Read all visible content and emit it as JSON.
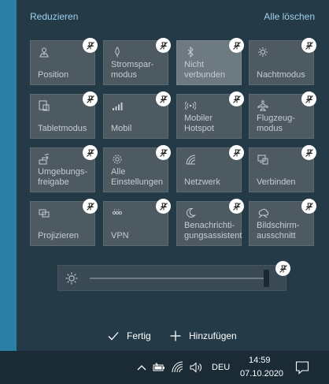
{
  "header": {
    "collapse_label": "Reduzieren",
    "clear_all_label": "Alle löschen"
  },
  "tiles": [
    {
      "label": "Position",
      "icon": "location-icon",
      "active": false
    },
    {
      "label": "Stromspar-\nmodus",
      "icon": "battery-saver-icon",
      "active": false
    },
    {
      "label": "Nicht\nverbunden",
      "icon": "bluetooth-icon",
      "active": true
    },
    {
      "label": "Nachtmodus",
      "icon": "night-light-icon",
      "active": false
    },
    {
      "label": "Tabletmodus",
      "icon": "tablet-mode-icon",
      "active": false
    },
    {
      "label": "Mobil",
      "icon": "cellular-icon",
      "active": false
    },
    {
      "label": "Mobiler\nHotspot",
      "icon": "hotspot-icon",
      "active": false
    },
    {
      "label": "Flugzeug-\nmodus",
      "icon": "airplane-icon",
      "active": false
    },
    {
      "label": "Umgebungs-\nfreigabe",
      "icon": "nearby-share-icon",
      "active": false
    },
    {
      "label": "Alle\nEinstellungen",
      "icon": "gear-icon",
      "active": false
    },
    {
      "label": "Netzwerk",
      "icon": "network-icon",
      "active": false
    },
    {
      "label": "Verbinden",
      "icon": "connect-icon",
      "active": false
    },
    {
      "label": "Projizieren",
      "icon": "project-icon",
      "active": false
    },
    {
      "label": "VPN",
      "icon": "vpn-icon",
      "active": false
    },
    {
      "label": "Benachrichti-\ngungsassistent",
      "icon": "focus-assist-icon",
      "active": false
    },
    {
      "label": "Bildschirm-\nausschnitt",
      "icon": "screen-snip-icon",
      "active": false
    }
  ],
  "brightness": {
    "level_percent": 100
  },
  "actions": {
    "done_label": "Fertig",
    "add_label": "Hinzufügen"
  },
  "taskbar": {
    "language": "DEU",
    "time": "14:59",
    "date": "07.10.2020"
  },
  "colors": {
    "accent_link": "#9fd0ec",
    "tile_bg": "#4e5a62",
    "tile_active_bg": "#6e7a82",
    "panel_bg": "#253a47",
    "desktop_accent": "#2a7fa5"
  }
}
